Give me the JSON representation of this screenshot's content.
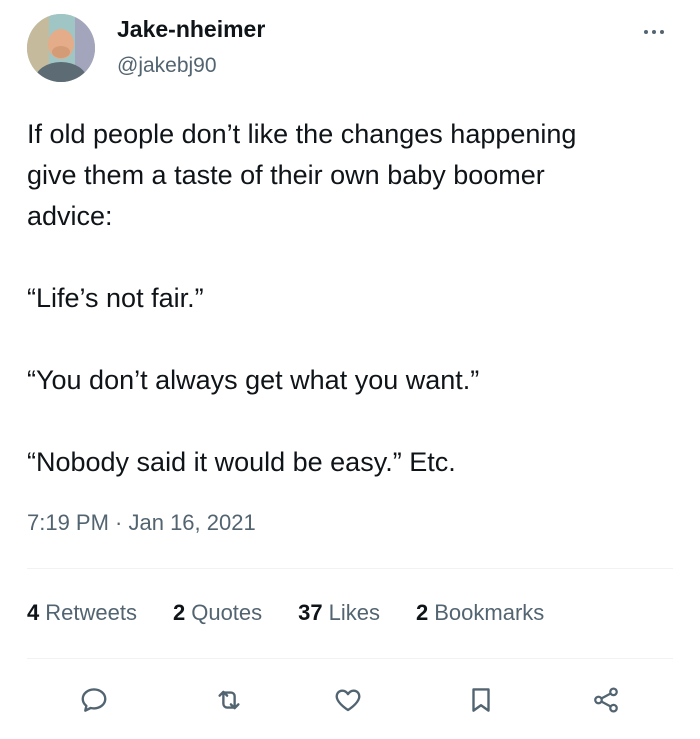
{
  "author": {
    "display_name": "Jake-nheimer",
    "handle": "@jakebj90"
  },
  "tweet": {
    "text": "If old people don’t like the changes happening\ngive them a taste of their own baby boomer\nadvice:\n\n“Life’s not fair.”\n\n“You don’t always get what you want.”\n\n“Nobody said it would be easy.” Etc.",
    "timestamp": "7:19 PM · Jan 16, 2021"
  },
  "stats": {
    "retweets_count": "4",
    "retweets_label": "Retweets",
    "quotes_count": "2",
    "quotes_label": "Quotes",
    "likes_count": "37",
    "likes_label": "Likes",
    "bookmarks_count": "2",
    "bookmarks_label": "Bookmarks"
  },
  "icons": {
    "more": "more-horizontal-icon",
    "reply": "reply-icon",
    "retweet": "retweet-icon",
    "like": "heart-icon",
    "bookmark": "bookmark-icon",
    "share": "share-icon"
  },
  "colors": {
    "text_primary": "#0f1419",
    "text_secondary": "#536471",
    "divider": "#eff3f4"
  }
}
